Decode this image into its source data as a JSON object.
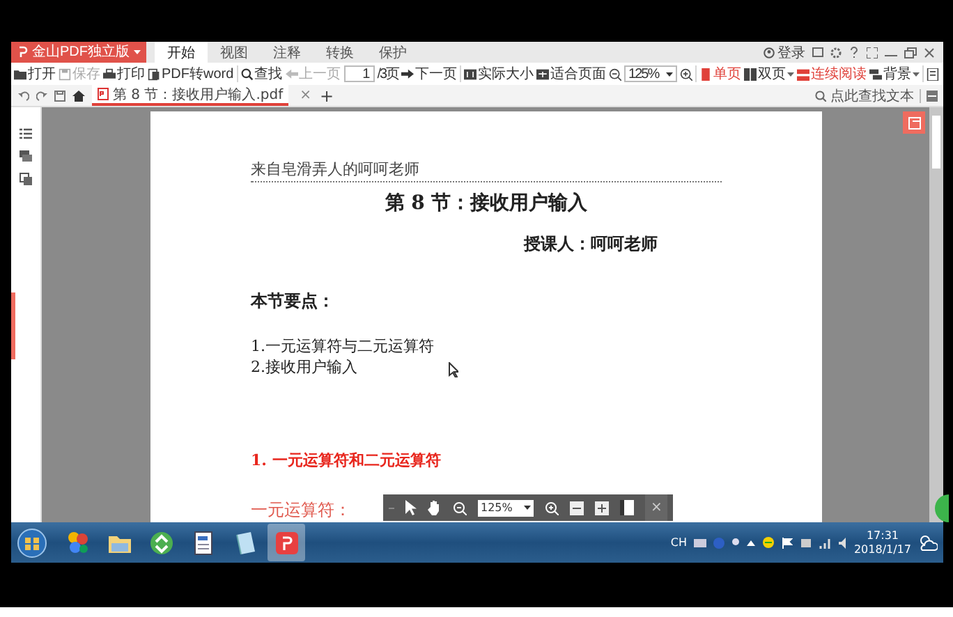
{
  "app_button": {
    "label": "金山PDF独立版"
  },
  "ribbon_tabs": [
    {
      "label": "开始",
      "selected": true
    },
    {
      "label": "视图",
      "selected": false
    },
    {
      "label": "注释",
      "selected": false
    },
    {
      "label": "转换",
      "selected": false
    },
    {
      "label": "保护",
      "selected": false
    }
  ],
  "account": {
    "label": "登录"
  },
  "toolbar": {
    "groups": [
      [
        {
          "kind": "button",
          "label": "打开",
          "disabled": false
        },
        {
          "kind": "button",
          "label": "保存",
          "disabled": true
        },
        {
          "kind": "button",
          "label": "打印",
          "disabled": false
        },
        {
          "kind": "button",
          "label": "PDF转word",
          "disabled": false
        }
      ],
      [
        {
          "kind": "button",
          "label": "查找",
          "disabled": false
        },
        {
          "kind": "button",
          "label": "上一页",
          "disabled": true
        },
        {
          "kind": "field",
          "value": "1"
        },
        {
          "kind": "text",
          "label": "/3页"
        },
        {
          "kind": "button",
          "label": "下一页",
          "disabled": false
        }
      ],
      [
        {
          "kind": "button",
          "label": "实际大小",
          "disabled": false
        },
        {
          "kind": "button",
          "label": "适合页面",
          "disabled": false
        },
        {
          "kind": "icon_button"
        },
        {
          "kind": "dropdown",
          "value": "125%"
        },
        {
          "kind": "icon_button"
        }
      ],
      [
        {
          "kind": "button",
          "label": "单页",
          "selected": true,
          "menu": false
        },
        {
          "kind": "button",
          "label": "双页",
          "selected": false,
          "menu": true
        },
        {
          "kind": "button",
          "label": "连续阅读",
          "selected": true,
          "menu": false
        },
        {
          "kind": "button",
          "label": "背景",
          "selected": false,
          "menu": true
        }
      ],
      [
        {
          "kind": "icon_button"
        }
      ]
    ]
  },
  "document_tabs": {
    "tabs": [
      {
        "label": "第 8 节：接收用户输入.pdf",
        "close": "×",
        "selected": true
      }
    ],
    "new_tab": "+",
    "search": {
      "placeholder": "点此查找文本"
    }
  },
  "page": {
    "header": "来自皂滑弄人的呵呵老师",
    "title": "第 8 节：接收用户输入",
    "lecturer": "授课人：呵呵老师",
    "section_heading": "本节要点：",
    "points": [
      "1.一元运算符与二元运算符",
      "2.接收用户输入"
    ],
    "red_heading": "1. 一元运算符和二元运算符",
    "subheading": "一元运算符："
  },
  "floating_toolbar": {
    "zoom": "125%",
    "close": "×"
  },
  "taskbar": {
    "apps": [
      {
        "selected": false
      },
      {
        "selected": false
      },
      {
        "selected": false
      },
      {
        "selected": false
      },
      {
        "selected": false
      },
      {
        "selected": true
      }
    ],
    "language": "CH",
    "time": "17:31",
    "date": "2018/1/17"
  }
}
